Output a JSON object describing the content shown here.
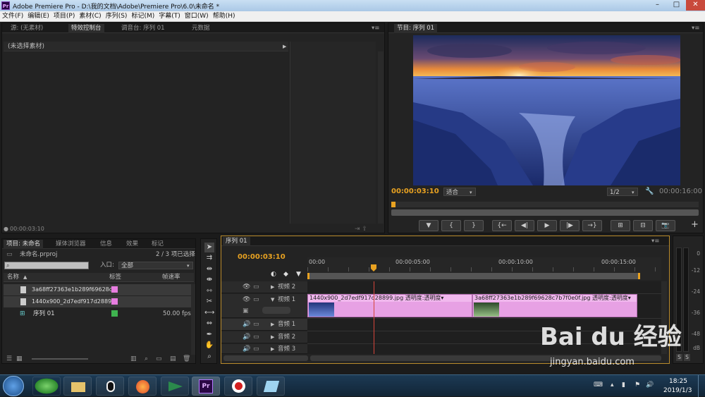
{
  "window": {
    "title": "Adobe Premiere Pro - D:\\我的文档\\Adobe\\Premiere Pro\\6.0\\未命名 *",
    "app_icon_text": "Pr",
    "minimize": "–",
    "maximize": "□",
    "close": "✕"
  },
  "menu": [
    "文件(F)",
    "编辑(E)",
    "项目(P)",
    "素材(C)",
    "序列(S)",
    "标记(M)",
    "字幕(T)",
    "窗口(W)",
    "帮助(H)"
  ],
  "source_panel": {
    "tabs": [
      "源: (无素材)",
      "特效控制台",
      "调音台: 序列 01",
      "元数据"
    ],
    "active_tab": 1,
    "no_clip": "(未选择素材)",
    "timecode": "00:00:03:10"
  },
  "program_panel": {
    "tab": "节目: 序列 01",
    "timecode": "00:00:03:10",
    "fit": "适合",
    "resolution": "1/2",
    "duration": "00:00:16:00",
    "transport": [
      "▼",
      "{",
      "}",
      "{←",
      "◀|",
      "▶",
      "|▶",
      "→}",
      "⊞",
      "⊟",
      "📷"
    ],
    "add": "+"
  },
  "project_panel": {
    "tabs": [
      "项目: 未命名",
      "媒体浏览器",
      "信息",
      "效果",
      "标记"
    ],
    "project_file": "未命名.prproj",
    "selection": "2 / 3 项已选择",
    "search_placeholder": "",
    "in_label": "入口:",
    "in_value": "全部",
    "columns": [
      "名称",
      "标签",
      "帧速率"
    ],
    "items": [
      {
        "name": "3a68ff27363e1b289f69628c",
        "color": "#e77de0",
        "fps": ""
      },
      {
        "name": "1440x900_2d7edf917d2889",
        "color": "#e77de0",
        "fps": ""
      },
      {
        "name": "序列 01",
        "color": "#3fb34f",
        "fps": "50.00 fps"
      }
    ]
  },
  "timeline": {
    "tab": "序列 01",
    "timecode": "00:00:03:10",
    "ruler": [
      "00:00",
      "00:00:05:00",
      "00:00:10:00",
      "00:00:15:00"
    ],
    "tracks": {
      "video2": "视频 2",
      "video1": "视频 1",
      "audio1": "音频 1",
      "audio2": "音频 2",
      "audio3": "音频 3"
    },
    "clips": [
      {
        "name": "1440x900_2d7edf917d28899.jpg",
        "fx": "透明度:透明度▾"
      },
      {
        "name": "3a68ff27363e1b289f69628c7b7f0e0f.jpg",
        "fx": "透明度:透明度▾"
      }
    ]
  },
  "audio_meter": {
    "labels": [
      "0",
      "-12",
      "-24",
      "-36",
      "-48",
      "dB"
    ],
    "solo": [
      "S",
      "S"
    ]
  },
  "taskbar": {
    "time": "18:25",
    "date": "2019/1/3"
  },
  "watermark": {
    "brand": "Bai du 经验",
    "url": "jingyan.baidu.com"
  }
}
